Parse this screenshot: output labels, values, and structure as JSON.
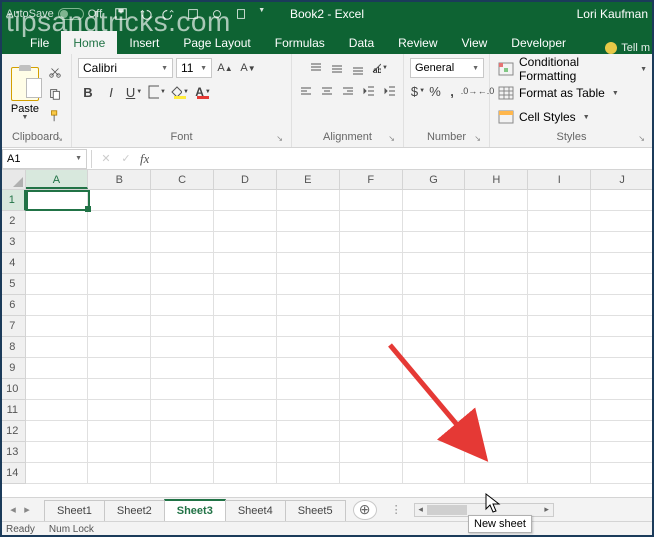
{
  "title": {
    "autosave": "AutoSave",
    "autosave_state": "Off",
    "doc": "Book2 - Excel",
    "user": "Lori Kaufman"
  },
  "tabs": {
    "file": "File",
    "home": "Home",
    "insert": "Insert",
    "pagelayout": "Page Layout",
    "formulas": "Formulas",
    "data": "Data",
    "review": "Review",
    "view": "View",
    "developer": "Developer",
    "tellme": "Tell m"
  },
  "clipboard": {
    "paste": "Paste",
    "label": "Clipboard"
  },
  "font": {
    "name": "Calibri",
    "size": "11",
    "label": "Font"
  },
  "alignment": {
    "label": "Alignment"
  },
  "number": {
    "format": "General",
    "label": "Number"
  },
  "styles": {
    "cond": "Conditional Formatting",
    "table": "Format as Table",
    "cell": "Cell Styles",
    "label": "Styles"
  },
  "namebox": "A1",
  "columns": [
    "A",
    "B",
    "C",
    "D",
    "E",
    "F",
    "G",
    "H",
    "I",
    "J"
  ],
  "rows": [
    "1",
    "2",
    "3",
    "4",
    "5",
    "6",
    "7",
    "8",
    "9",
    "10",
    "11",
    "12",
    "13",
    "14"
  ],
  "sheets": [
    "Sheet1",
    "Sheet2",
    "Sheet3",
    "Sheet4",
    "Sheet5"
  ],
  "active_sheet": 2,
  "tooltip": "New sheet",
  "status": {
    "ready": "Ready",
    "numlock": "Num Lock"
  },
  "watermark": "tipsandtricks.com"
}
